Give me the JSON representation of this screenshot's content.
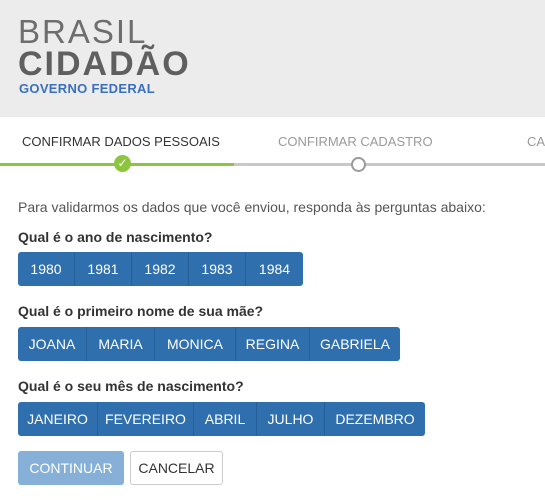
{
  "brand": {
    "line1": "BRASIL",
    "line2": "CIDADÃO",
    "line3": "GOVERNO FEDERAL"
  },
  "steps": [
    {
      "label": "CONFIRMAR DADOS PESSOAIS",
      "state": "done"
    },
    {
      "label": "CONFIRMAR CADASTRO",
      "state": "pending"
    },
    {
      "label": "CA",
      "state": "pending"
    }
  ],
  "intro": "Para validarmos os dados que você enviou, responda às perguntas abaixo:",
  "questions": [
    {
      "text": "Qual é o ano de nascimento?",
      "options": [
        "1980",
        "1981",
        "1982",
        "1983",
        "1984"
      ]
    },
    {
      "text": "Qual é o primeiro nome de sua mãe?",
      "options": [
        "JOANA",
        "MARIA",
        "MONICA",
        "REGINA",
        "GABRIELA"
      ]
    },
    {
      "text": "Qual é o seu mês de nascimento?",
      "options": [
        "JANEIRO",
        "FEVEREIRO",
        "ABRIL",
        "JULHO",
        "DEZEMBRO"
      ]
    }
  ],
  "actions": {
    "continue_label": "CONTINUAR",
    "cancel_label": "CANCELAR"
  },
  "colors": {
    "accent": "#2f6fae",
    "progress_done": "#8cc63f",
    "brand_blue": "#3a6fbf"
  },
  "icons": {
    "step_done": "check-icon",
    "step_current": "circle-icon"
  }
}
